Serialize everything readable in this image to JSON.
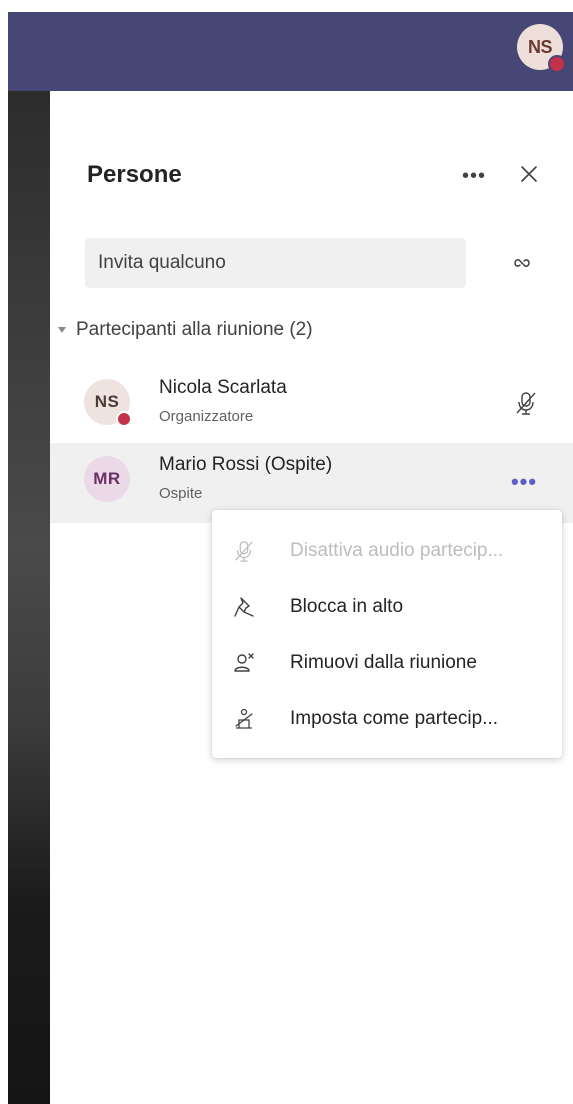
{
  "header": {
    "user_initials": "NS",
    "presence_color": "#c4314b",
    "bar_color": "#464775"
  },
  "panel": {
    "title": "Persone",
    "more_icon": "more-horizontal-icon",
    "more_label": "•••",
    "close_icon": "close-icon",
    "invite_placeholder": "Invita qualcuno",
    "link_icon": "link-icon"
  },
  "participants": {
    "section_label": "Partecipanti alla riunione (2)",
    "items": [
      {
        "initials": "NS",
        "name": "Nicola Scarlata",
        "role": "Organizzatore",
        "status": "busy",
        "action_icon": "mic-off-icon"
      },
      {
        "initials": "MR",
        "name": "Mario Rossi (Ospite)",
        "role": "Ospite",
        "action_icon": "more-horizontal-icon",
        "action_label": "•••"
      }
    ]
  },
  "context_menu": {
    "items": [
      {
        "label": "Disattiva audio partecip...",
        "icon": "mic-off-icon",
        "enabled": false
      },
      {
        "label": "Blocca in alto",
        "icon": "pin-icon",
        "enabled": true
      },
      {
        "label": "Rimuovi dalla riunione",
        "icon": "remove-person-icon",
        "enabled": true
      },
      {
        "label": "Imposta come partecip...",
        "icon": "attendee-icon",
        "enabled": true
      }
    ]
  },
  "colors": {
    "accent": "#5b5fc7",
    "hover_row": "#f0f0f0",
    "disabled_text": "#bdbdbd"
  }
}
